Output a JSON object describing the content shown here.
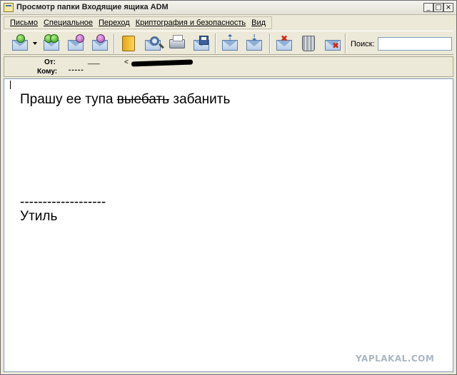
{
  "window": {
    "title": "Просмотр папки Входящие ящика ADM",
    "min_glyph": "_",
    "max_glyph": "□",
    "close_glyph": "×"
  },
  "menu": {
    "items": [
      {
        "label": "Письмо"
      },
      {
        "label": "Специальное"
      },
      {
        "label": "Переход"
      },
      {
        "label": "Криптография и безопасность"
      },
      {
        "label": "Вид"
      }
    ]
  },
  "toolbar": {
    "search_label": "Поиск:",
    "search_value": "",
    "icons": [
      "get-mail-icon",
      "reply-all-icon",
      "reply-icon",
      "forward-icon",
      "address-book-icon",
      "find-icon",
      "print-icon",
      "save-icon",
      "move-up-icon",
      "move-down-icon",
      "mark-junk-icon",
      "delete-icon",
      "delete-forever-icon"
    ]
  },
  "header": {
    "from_label": "От:",
    "from_name": "___",
    "from_addr": "<",
    "to_label": "Кому:",
    "to_value": "-----"
  },
  "message": {
    "line1_prefix": "Прашу ее тупа ",
    "line1_struck": "выебать",
    "line1_suffix": " забанить",
    "signature_sep": "-------------------",
    "signature": "Утиль"
  },
  "watermark": "YAPLAKAL.COM"
}
